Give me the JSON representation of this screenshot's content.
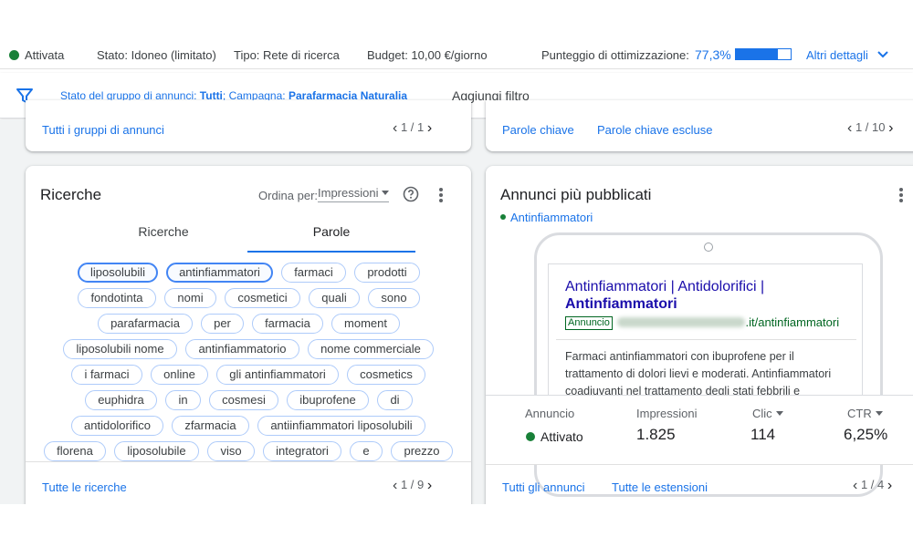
{
  "status": {
    "state": "Attivata",
    "stato": "Stato: Idoneo (limitato)",
    "tipo": "Tipo: Rete di ricerca",
    "budget": "Budget: 10,00 €/giorno",
    "optimization_label": "Punteggio di ottimizzazione:",
    "optimization_value": "77,3%",
    "optimization_fraction": 0.773,
    "details": "Altri dettagli",
    "colors": {
      "active": "#188038",
      "accent": "#1a73e8"
    }
  },
  "filter": {
    "prefix": "Stato del gruppo di annunci:",
    "value1": "Tutti",
    "mid": "; Campagna:",
    "value2": "Parafarmacia Naturalia",
    "add": "Aggiungi filtro"
  },
  "top_left": {
    "link": "Tutti i gruppi di annunci",
    "pager": "1 / 1"
  },
  "top_right": {
    "link1": "Parole chiave",
    "link2": "Parole chiave escluse",
    "pager": "1 / 10"
  },
  "searches": {
    "title": "Ricerche",
    "sort_label": "Ordina per:",
    "sort_value": "Impressioni",
    "tabs": [
      "Ricerche",
      "Parole"
    ],
    "active_tab": 1,
    "rows": [
      [
        "liposolubili",
        "antinfiammatori",
        "farmaci",
        "prodotti"
      ],
      [
        "fondotinta",
        "nomi",
        "cosmetici",
        "quali",
        "sono"
      ],
      [
        "parafarmacia",
        "per",
        "farmacia",
        "moment"
      ],
      [
        "liposolubili nome",
        "antinfiammatorio",
        "nome commerciale"
      ],
      [
        "i farmaci",
        "online",
        "gli antinfiammatori",
        "cosmetics"
      ],
      [
        "euphidra",
        "in",
        "cosmesi",
        "ibuprofene",
        "di"
      ],
      [
        "antidolorifico",
        "zfarmacia",
        "antiinfiammatori liposolubili"
      ],
      [
        "florena",
        "liposolubile",
        "viso",
        "integratori",
        "e",
        "prezzo"
      ]
    ],
    "footer_link": "Tutte le ricerche",
    "pager": "1 / 9"
  },
  "ads": {
    "title": "Annunci più pubblicati",
    "group": "Antinfiammatori",
    "headline1": "Antinfiammatori | Antidolorifici |",
    "headline2": "Antinfiammatori",
    "badge": "Annuncio",
    "url_suffix": ".it/antinfiammatori",
    "description": [
      "Farmaci antinfiammatori con ibuprofene per il",
      "trattamento di dolori lievi e moderati. Antinfiammatori",
      "coadiuvanti nel trattamento degli stati febbrili e"
    ],
    "stats": {
      "ad_label": "Annuncio",
      "ad_status": "Attivato",
      "impr_label": "Impressioni",
      "impr_value": "1.825",
      "clic_label": "Clic",
      "clic_value": "114",
      "ctr_label": "CTR",
      "ctr_value": "6,25%"
    },
    "footer_link1": "Tutti gli annunci",
    "footer_link2": "Tutte le estensioni",
    "pager": "1 / 4"
  }
}
